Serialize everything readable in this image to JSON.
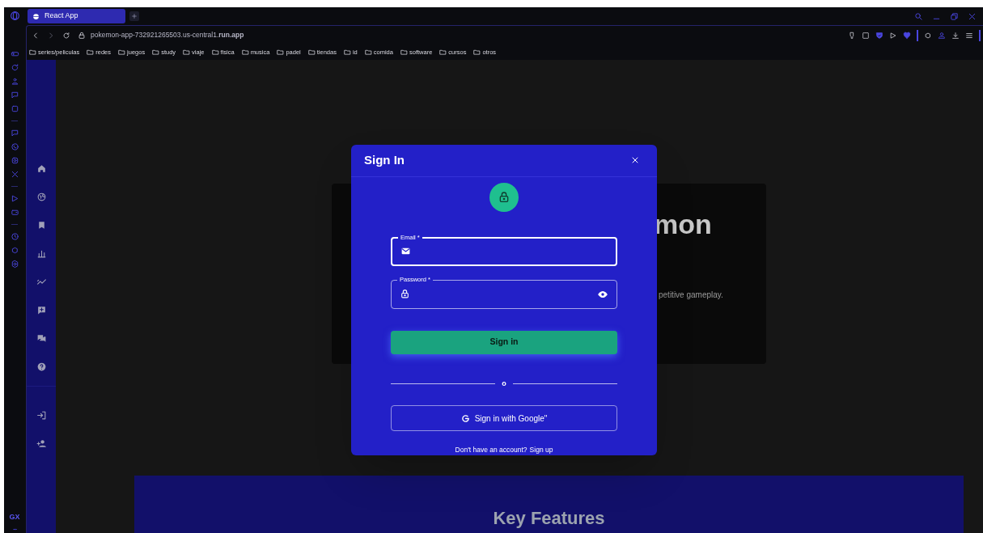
{
  "browser": {
    "tabs": [
      {
        "title": "React App",
        "selected": true
      }
    ],
    "address": "pokemon-app-732921265503.us-central1.**run.app**",
    "bookmarks": [
      "series/peliculas",
      "redes",
      "juegos",
      "study",
      "viaje",
      "fisica",
      "musica",
      "padel",
      "tiendas",
      "id",
      "comida",
      "software",
      "cursos",
      "otros"
    ],
    "sidebar_label": "GX"
  },
  "page": {
    "hero_title_fragment": "mon",
    "hero_text_fragment": "petitive gameplay.",
    "features_title": "Key Features"
  },
  "dialog": {
    "title": "Sign In",
    "fields": [
      {
        "label": "Email *",
        "kind": "email",
        "focused": true
      },
      {
        "label": "Password *",
        "kind": "password",
        "focused": false
      }
    ],
    "submit": "Sign in",
    "divider": "o",
    "google_button": "Sign in with Google\"",
    "footer_text": "Don't have an account?",
    "footer_link": "Sign up"
  }
}
